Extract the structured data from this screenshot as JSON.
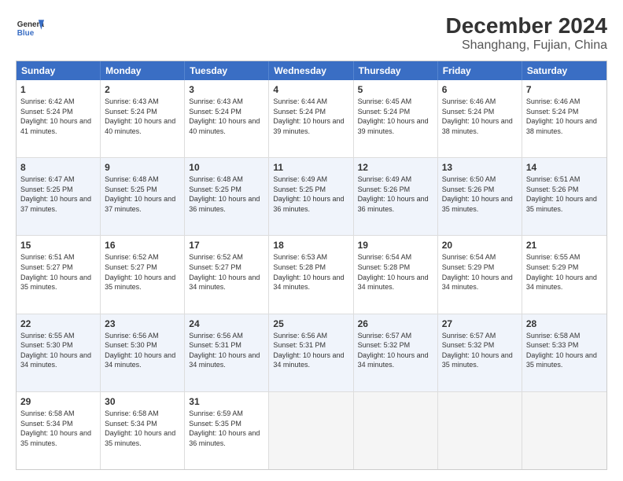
{
  "header": {
    "logo_line1": "General",
    "logo_line2": "Blue",
    "title": "December 2024",
    "subtitle": "Shanghang, Fujian, China"
  },
  "calendar": {
    "days_of_week": [
      "Sunday",
      "Monday",
      "Tuesday",
      "Wednesday",
      "Thursday",
      "Friday",
      "Saturday"
    ],
    "weeks": [
      [
        {
          "day": "",
          "empty": true
        },
        {
          "day": "",
          "empty": true
        },
        {
          "day": "",
          "empty": true
        },
        {
          "day": "",
          "empty": true
        },
        {
          "day": "",
          "empty": true
        },
        {
          "day": "",
          "empty": true
        },
        {
          "day": "",
          "empty": true
        }
      ],
      [
        {
          "day": "1",
          "sunrise": "6:42 AM",
          "sunset": "5:24 PM",
          "daylight": "10 hours and 41 minutes."
        },
        {
          "day": "2",
          "sunrise": "6:43 AM",
          "sunset": "5:24 PM",
          "daylight": "10 hours and 40 minutes."
        },
        {
          "day": "3",
          "sunrise": "6:43 AM",
          "sunset": "5:24 PM",
          "daylight": "10 hours and 40 minutes."
        },
        {
          "day": "4",
          "sunrise": "6:44 AM",
          "sunset": "5:24 PM",
          "daylight": "10 hours and 39 minutes."
        },
        {
          "day": "5",
          "sunrise": "6:45 AM",
          "sunset": "5:24 PM",
          "daylight": "10 hours and 39 minutes."
        },
        {
          "day": "6",
          "sunrise": "6:46 AM",
          "sunset": "5:24 PM",
          "daylight": "10 hours and 38 minutes."
        },
        {
          "day": "7",
          "sunrise": "6:46 AM",
          "sunset": "5:24 PM",
          "daylight": "10 hours and 38 minutes."
        }
      ],
      [
        {
          "day": "8",
          "sunrise": "6:47 AM",
          "sunset": "5:25 PM",
          "daylight": "10 hours and 37 minutes."
        },
        {
          "day": "9",
          "sunrise": "6:48 AM",
          "sunset": "5:25 PM",
          "daylight": "10 hours and 37 minutes."
        },
        {
          "day": "10",
          "sunrise": "6:48 AM",
          "sunset": "5:25 PM",
          "daylight": "10 hours and 36 minutes."
        },
        {
          "day": "11",
          "sunrise": "6:49 AM",
          "sunset": "5:25 PM",
          "daylight": "10 hours and 36 minutes."
        },
        {
          "day": "12",
          "sunrise": "6:49 AM",
          "sunset": "5:26 PM",
          "daylight": "10 hours and 36 minutes."
        },
        {
          "day": "13",
          "sunrise": "6:50 AM",
          "sunset": "5:26 PM",
          "daylight": "10 hours and 35 minutes."
        },
        {
          "day": "14",
          "sunrise": "6:51 AM",
          "sunset": "5:26 PM",
          "daylight": "10 hours and 35 minutes."
        }
      ],
      [
        {
          "day": "15",
          "sunrise": "6:51 AM",
          "sunset": "5:27 PM",
          "daylight": "10 hours and 35 minutes."
        },
        {
          "day": "16",
          "sunrise": "6:52 AM",
          "sunset": "5:27 PM",
          "daylight": "10 hours and 35 minutes."
        },
        {
          "day": "17",
          "sunrise": "6:52 AM",
          "sunset": "5:27 PM",
          "daylight": "10 hours and 34 minutes."
        },
        {
          "day": "18",
          "sunrise": "6:53 AM",
          "sunset": "5:28 PM",
          "daylight": "10 hours and 34 minutes."
        },
        {
          "day": "19",
          "sunrise": "6:54 AM",
          "sunset": "5:28 PM",
          "daylight": "10 hours and 34 minutes."
        },
        {
          "day": "20",
          "sunrise": "6:54 AM",
          "sunset": "5:29 PM",
          "daylight": "10 hours and 34 minutes."
        },
        {
          "day": "21",
          "sunrise": "6:55 AM",
          "sunset": "5:29 PM",
          "daylight": "10 hours and 34 minutes."
        }
      ],
      [
        {
          "day": "22",
          "sunrise": "6:55 AM",
          "sunset": "5:30 PM",
          "daylight": "10 hours and 34 minutes."
        },
        {
          "day": "23",
          "sunrise": "6:56 AM",
          "sunset": "5:30 PM",
          "daylight": "10 hours and 34 minutes."
        },
        {
          "day": "24",
          "sunrise": "6:56 AM",
          "sunset": "5:31 PM",
          "daylight": "10 hours and 34 minutes."
        },
        {
          "day": "25",
          "sunrise": "6:56 AM",
          "sunset": "5:31 PM",
          "daylight": "10 hours and 34 minutes."
        },
        {
          "day": "26",
          "sunrise": "6:57 AM",
          "sunset": "5:32 PM",
          "daylight": "10 hours and 34 minutes."
        },
        {
          "day": "27",
          "sunrise": "6:57 AM",
          "sunset": "5:32 PM",
          "daylight": "10 hours and 35 minutes."
        },
        {
          "day": "28",
          "sunrise": "6:58 AM",
          "sunset": "5:33 PM",
          "daylight": "10 hours and 35 minutes."
        }
      ],
      [
        {
          "day": "29",
          "sunrise": "6:58 AM",
          "sunset": "5:34 PM",
          "daylight": "10 hours and 35 minutes."
        },
        {
          "day": "30",
          "sunrise": "6:58 AM",
          "sunset": "5:34 PM",
          "daylight": "10 hours and 35 minutes."
        },
        {
          "day": "31",
          "sunrise": "6:59 AM",
          "sunset": "5:35 PM",
          "daylight": "10 hours and 36 minutes."
        },
        {
          "day": "",
          "empty": true
        },
        {
          "day": "",
          "empty": true
        },
        {
          "day": "",
          "empty": true
        },
        {
          "day": "",
          "empty": true
        }
      ]
    ]
  }
}
